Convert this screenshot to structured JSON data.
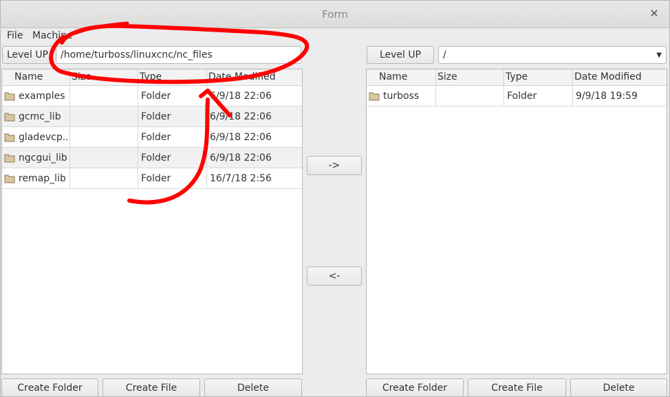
{
  "window": {
    "title": "Form"
  },
  "menu": {
    "items": [
      "File",
      "Machine"
    ]
  },
  "left": {
    "level_up_label": "Level UP",
    "path_value": "/home/turboss/linuxcnc/nc_files",
    "columns": [
      "Name",
      "Size",
      "Type",
      "Date Modified"
    ],
    "rows": [
      {
        "name": "examples",
        "size": "",
        "type": "Folder",
        "date": "6/9/18 22:06"
      },
      {
        "name": "gcmc_lib",
        "size": "",
        "type": "Folder",
        "date": "6/9/18 22:06"
      },
      {
        "name": "gladevcp...",
        "size": "",
        "type": "Folder",
        "date": "6/9/18 22:06"
      },
      {
        "name": "ngcgui_lib",
        "size": "",
        "type": "Folder",
        "date": "6/9/18 22:06"
      },
      {
        "name": "remap_lib",
        "size": "",
        "type": "Folder",
        "date": "16/7/18 2:56"
      }
    ],
    "buttons": {
      "create_folder": "Create Folder",
      "create_file": "Create File",
      "delete": "Delete"
    }
  },
  "middle": {
    "copy_right_label": "->",
    "copy_left_label": "<-"
  },
  "right": {
    "level_up_label": "Level UP",
    "combo_value": "/",
    "columns": [
      "Name",
      "Size",
      "Type",
      "Date Modified"
    ],
    "rows": [
      {
        "name": "turboss",
        "size": "",
        "type": "Folder",
        "date": "9/9/18 19:59"
      }
    ],
    "buttons": {
      "create_folder": "Create Folder",
      "create_file": "Create File",
      "delete": "Delete"
    }
  },
  "colors": {
    "annotation": "#ff0000",
    "folder_icon": "#d8c6a0"
  }
}
